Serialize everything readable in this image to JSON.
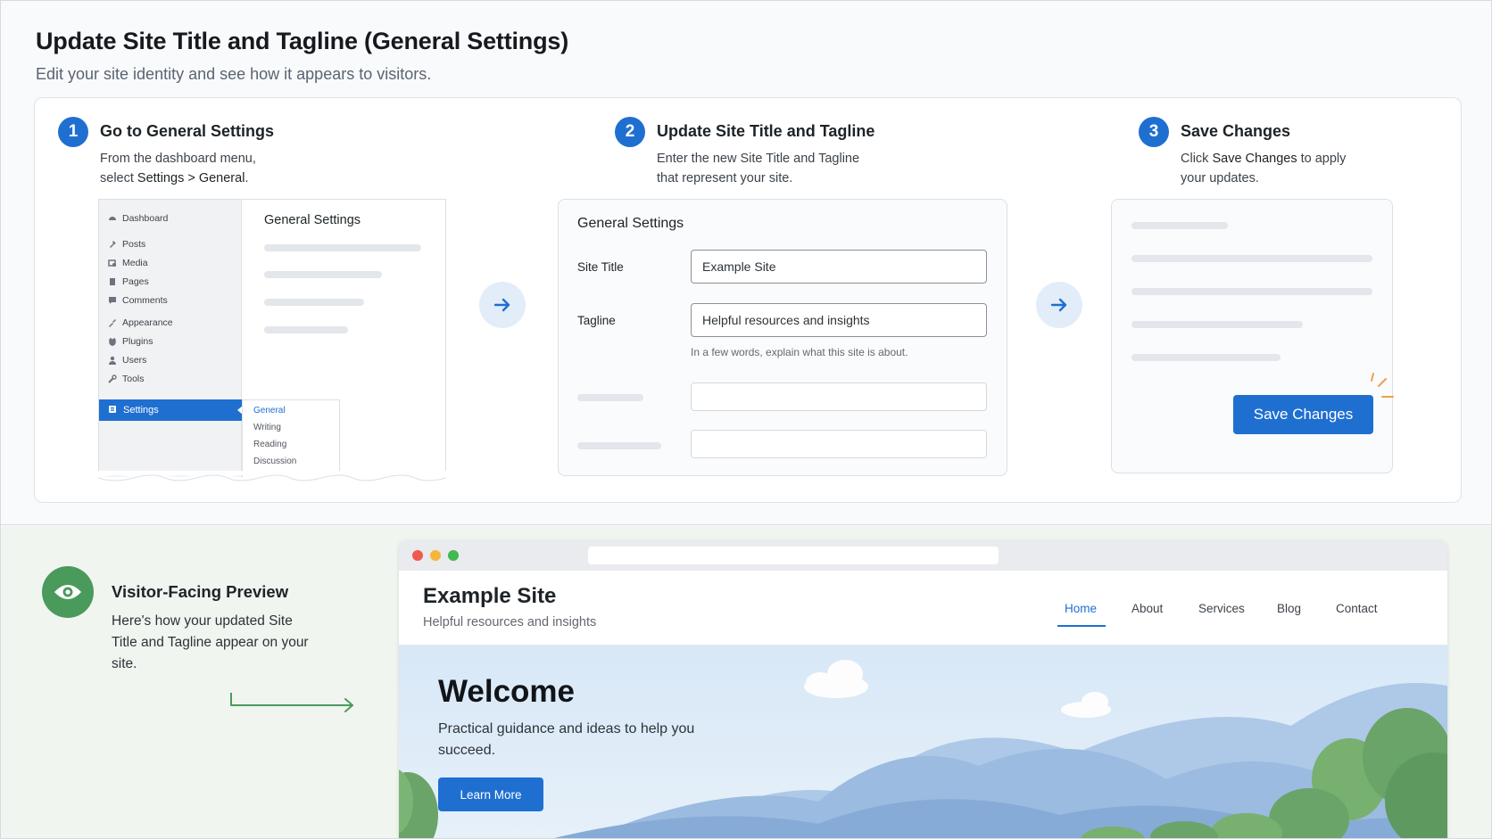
{
  "page": {
    "title": "Update Site Title and Tagline (General Settings)",
    "subtitle": "Edit your site identity and see how it appears to visitors."
  },
  "steps": [
    {
      "number": "1",
      "title": "Go to General Settings",
      "desc_line1": "From the dashboard menu,",
      "desc_line2_prefix": "select ",
      "desc_line2_path": "Settings > General",
      "desc_line2_suffix": "."
    },
    {
      "number": "2",
      "title": "Update Site Title and Tagline",
      "desc_line1": "Enter the new Site Title and Tagline",
      "desc_line2": "that represent your site."
    },
    {
      "number": "3",
      "title": "Save Changes",
      "desc_prefix": "Click ",
      "desc_bold": "Save Changes",
      "desc_suffix": " to apply",
      "desc_line2": "your updates."
    }
  ],
  "admin_menu": {
    "items": [
      "Dashboard",
      "Posts",
      "Media",
      "Pages",
      "Comments",
      "Appearance",
      "Plugins",
      "Users",
      "Tools"
    ],
    "icons": [
      "dashboard-icon",
      "posts-icon",
      "media-icon",
      "pages-icon",
      "comments-icon",
      "appearance-icon",
      "plugins-icon",
      "users-icon",
      "tools-icon"
    ],
    "active": "Settings",
    "submenu": [
      "General",
      "Writing",
      "Reading",
      "Discussion"
    ],
    "submenu_current": "General"
  },
  "general_settings": {
    "heading": "General Settings",
    "site_title_label": "Site Title",
    "site_title_value": "Example Site",
    "tagline_label": "Tagline",
    "tagline_value": "Helpful resources and insights",
    "tagline_help": "In a few words, explain what this site is about."
  },
  "save": {
    "button_label": "Save Changes"
  },
  "preview": {
    "title": "Visitor-Facing Preview",
    "desc": "Here's how your updated Site Title and Tagline appear on your site."
  },
  "site": {
    "name": "Example Site",
    "tagline": "Helpful resources and insights",
    "nav": [
      "Home",
      "About",
      "Services",
      "Blog",
      "Contact"
    ],
    "nav_active": "Home",
    "hero_title": "Welcome",
    "hero_subtitle": "Practical guidance and ideas to help you succeed.",
    "cta_label": "Learn More"
  },
  "colors": {
    "accent": "#1f6fd1",
    "preview_green": "#4a9a5c",
    "dot_red": "#ee5a4f",
    "dot_yellow": "#f5b73b",
    "dot_green": "#3fb950"
  }
}
